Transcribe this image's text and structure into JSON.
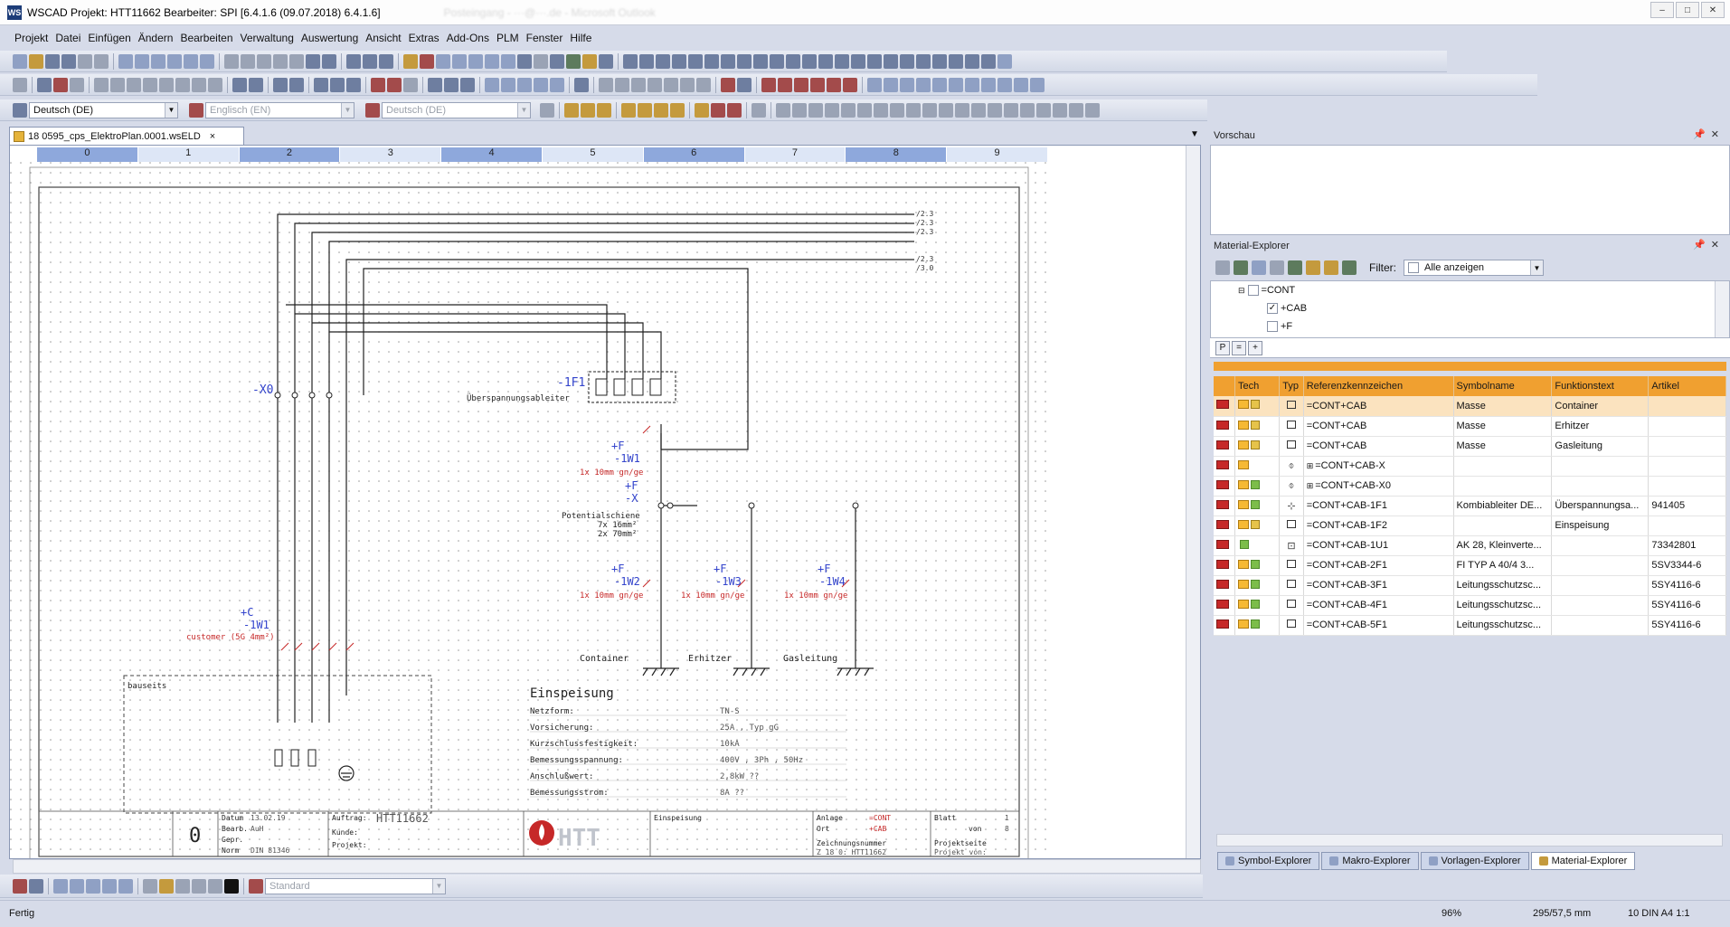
{
  "window": {
    "title": "WSCAD  Projekt: HTT11662  Bearbeiter: SPI [6.4.1.6 (09.07.2018) 6.4.1.6]",
    "blurred_title": "Posteingang - ···@···.de - Microsoft Outlook",
    "minimize": "–",
    "maximize": "□",
    "close": "✕"
  },
  "menu": [
    "Projekt",
    "Datei",
    "Einfügen",
    "Ändern",
    "Bearbeiten",
    "Verwaltung",
    "Auswertung",
    "Ansicht",
    "Extras",
    "Add-Ons",
    "PLM",
    "Fenster",
    "Hilfe"
  ],
  "language_toolbar": {
    "lang1": "Deutsch (DE)",
    "lang2": "Englisch (EN)",
    "lang3": "Deutsch (DE)"
  },
  "document_tab": {
    "label": "18 0595_cps_ElektroPlan.0001.wsELD",
    "close": "×"
  },
  "ruler": [
    "0",
    "1",
    "2",
    "3",
    "4",
    "5",
    "6",
    "7",
    "8",
    "9"
  ],
  "drawing": {
    "x0": "-X0",
    "f1": "-1F1",
    "f1_desc": "Überspannungsableiter",
    "w1_loc": "+F",
    "w1": "-1W1",
    "w1_cable": "1x 10mm gn/ge",
    "x_loc": "+F",
    "x": "-X",
    "x_desc1": "Potentialschiene",
    "x_desc2": "7x 16mm²",
    "x_desc3": "2x 70mm²",
    "w2_loc": "+F",
    "w2": "-1W2",
    "w2_cable": "1x 10mm gn/ge",
    "w3_loc": "+F",
    "w3": "-1W3",
    "w3_cable": "1x 10mm gn/ge",
    "w4_loc": "+F",
    "w4": "-1W4",
    "w4_cable": "1x 10mm gn/ge",
    "container": "Container",
    "erhitzer": "Erhitzer",
    "gasleitung": "Gasleitung",
    "cw1_loc": "+C",
    "cw1": "-1W1",
    "cw1_cable": "customer (5G 4mm²)",
    "bauseits": "bauseits",
    "refs": [
      "/2.3",
      "/2.3",
      "/2.3",
      "/2.3",
      "/3.0"
    ],
    "einspeisung": {
      "title": "Einspeisung",
      "rows": [
        {
          "label": "Netzform:",
          "value": "TN-S"
        },
        {
          "label": "Vorsicherung:",
          "value": "25A , Typ gG"
        },
        {
          "label": "Kurzschlussfestigkeit:",
          "value": "10kA"
        },
        {
          "label": "Bemessungsspannung:",
          "value": "400V , 3Ph , 50Hz"
        },
        {
          "label": "Anschlußwert:",
          "value": "2,8kW ??"
        },
        {
          "label": "Bemessungsstrom:",
          "value": "8A ??"
        }
      ]
    },
    "titleblock": {
      "rev": "0",
      "datum_l": "Datum",
      "datum": "13.02.19",
      "bearb_l": "Bearb.",
      "bearb": "AuH",
      "gepr_l": "Gepr.",
      "norm_l": "Norm",
      "norm": "DIN 81346",
      "auftrag_l": "Auftrag:",
      "auftrag": "HTT11662",
      "kunde_l": "Kunde:",
      "projekt_l": "Projekt:",
      "logo": "HTT",
      "sheet_title": "Einspeisung",
      "anlage_l": "Anlage",
      "anlage": "=CONT",
      "ort_l": "Ort",
      "ort": "+CAB",
      "zeichnr_l": "Zeichnungsnummer",
      "zeichnr": "Z 18 0: HTT11662",
      "projseite_l": "Projektseite",
      "projseite": "Projekt von:",
      "blatt_l": "Blatt",
      "blatt": "1",
      "von_l": "von",
      "von": "8"
    }
  },
  "vorschau": {
    "title": "Vorschau",
    "pin": "⯝",
    "close": "✕"
  },
  "material_explorer": {
    "title": "Material-Explorer",
    "filter_label": "Filter:",
    "filter_value": "Alle anzeigen",
    "tree": [
      {
        "label": "=CONT",
        "checked": false
      },
      {
        "label": "+CAB",
        "checked": true
      },
      {
        "label": "+F",
        "checked": false
      }
    ],
    "ptabs": [
      "P",
      "=",
      "+"
    ],
    "columns": [
      "",
      "Tech",
      "Typ",
      "Referenzkennzeichen",
      "Symbolname",
      "Funktionstext",
      "Artikel"
    ],
    "rows": [
      {
        "ref": "=CONT+CAB",
        "sym": "Masse",
        "func": "Container",
        "art": "",
        "typ": "sq",
        "sel": true,
        "tech": "lock"
      },
      {
        "ref": "=CONT+CAB",
        "sym": "Masse",
        "func": "Erhitzer",
        "art": "",
        "typ": "sq",
        "sel": false,
        "tech": "lock"
      },
      {
        "ref": "=CONT+CAB",
        "sym": "Masse",
        "func": "Gasleitung",
        "art": "",
        "typ": "sq",
        "sel": false,
        "tech": "lock"
      },
      {
        "ref": "=CONT+CAB-X",
        "sym": "",
        "func": "",
        "art": "",
        "typ": "conn",
        "sel": false,
        "tech": "none",
        "expand": "⊞"
      },
      {
        "ref": "=CONT+CAB-X0",
        "sym": "",
        "func": "",
        "art": "",
        "typ": "conn",
        "sel": false,
        "tech": "green",
        "expand": "⊞"
      },
      {
        "ref": "=CONT+CAB-1F1",
        "sym": "Kombiableiter DE...",
        "func": "Überspannungsa...",
        "art": "941405",
        "typ": "cross",
        "sel": false,
        "tech": "green"
      },
      {
        "ref": "=CONT+CAB-1F2",
        "sym": "",
        "func": "Einspeisung",
        "art": "",
        "typ": "sq",
        "sel": false,
        "tech": "lock"
      },
      {
        "ref": "=CONT+CAB-1U1",
        "sym": "AK 28, Kleinverte...",
        "func": "",
        "art": "73342801",
        "typ": "box",
        "sel": false,
        "tech": "green-only"
      },
      {
        "ref": "=CONT+CAB-2F1",
        "sym": "FI TYP A 40/4 3...",
        "func": "",
        "art": "5SV3344-6",
        "typ": "sq",
        "sel": false,
        "tech": "green"
      },
      {
        "ref": "=CONT+CAB-3F1",
        "sym": "Leitungsschutzsc...",
        "func": "",
        "art": "5SY4116-6",
        "typ": "sq",
        "sel": false,
        "tech": "green"
      },
      {
        "ref": "=CONT+CAB-4F1",
        "sym": "Leitungsschutzsc...",
        "func": "",
        "art": "5SY4116-6",
        "typ": "sq",
        "sel": false,
        "tech": "green"
      },
      {
        "ref": "=CONT+CAB-5F1",
        "sym": "Leitungsschutzsc...",
        "func": "",
        "art": "5SY4116-6",
        "typ": "sq",
        "sel": false,
        "tech": "green"
      }
    ]
  },
  "explorer_tabs": [
    "Symbol-Explorer",
    "Makro-Explorer",
    "Vorlagen-Explorer",
    "Material-Explorer"
  ],
  "bottom_toolbar": {
    "style": "Standard"
  },
  "status": {
    "left": "Fertig",
    "zoom": "96%",
    "coords": "295/57,5 mm",
    "sheet": "10  DIN A4  1:1"
  }
}
